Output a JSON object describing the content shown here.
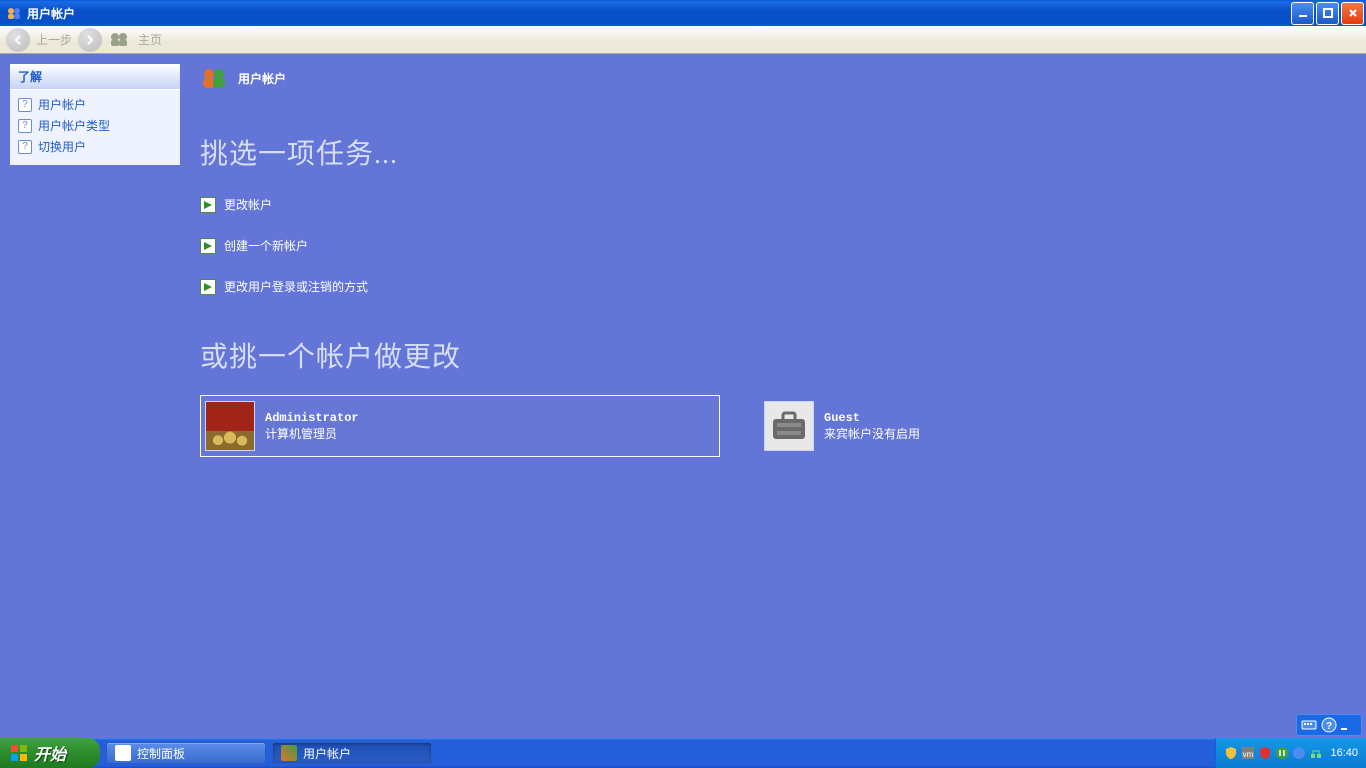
{
  "window": {
    "title": "用户帐户"
  },
  "toolbar": {
    "back": "上一步",
    "home": "主页"
  },
  "sidebar": {
    "learn_title": "了解",
    "items": [
      "用户帐户",
      "用户帐户类型",
      "切换用户"
    ]
  },
  "main": {
    "header": "用户帐户",
    "task_heading": "挑选一项任务...",
    "tasks": [
      "更改帐户",
      "创建一个新帐户",
      "更改用户登录或注销的方式"
    ],
    "pick_heading": "或挑一个帐户做更改",
    "accounts": [
      {
        "name": "Administrator",
        "role": "计算机管理员",
        "selected": true,
        "pic": "chess"
      },
      {
        "name": "Guest",
        "role": "来宾帐户没有启用",
        "selected": false,
        "pic": "suitcase"
      }
    ]
  },
  "taskbar": {
    "start": "开始",
    "buttons": [
      "控制面板",
      "用户帐户"
    ],
    "clock": "16:40"
  }
}
